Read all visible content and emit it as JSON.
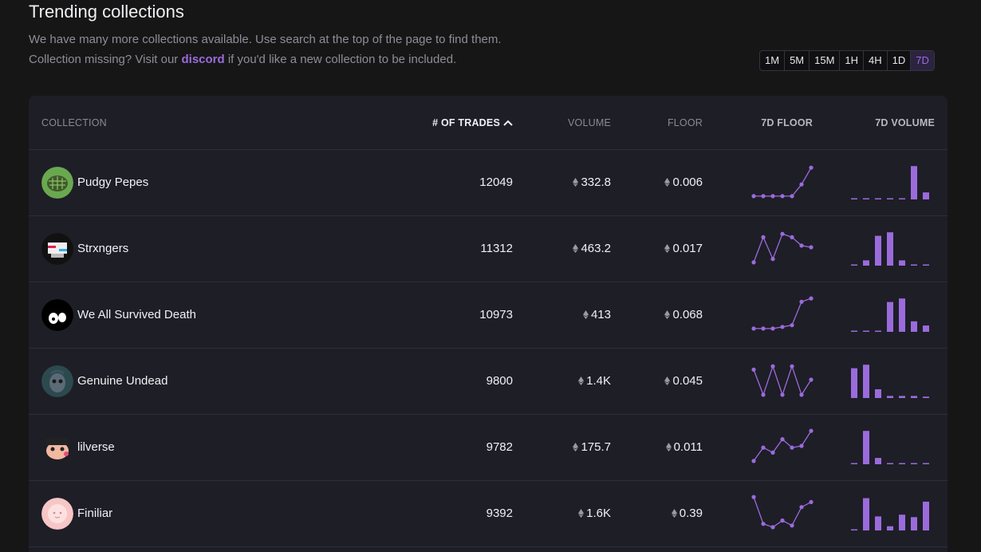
{
  "header": {
    "title": "Trending collections",
    "line1": "We have many more collections available. Use search at the top of the page to find them.",
    "line2_before": "Collection missing? Visit our ",
    "line2_link": "discord",
    "line2_after": " if you'd like a new collection to be included."
  },
  "timeframes": [
    "1M",
    "5M",
    "15M",
    "1H",
    "4H",
    "1D",
    "7D"
  ],
  "active_timeframe": "7D",
  "colors": {
    "accent": "#9b6bdc",
    "background": "#161616",
    "card": "#1e1e27"
  },
  "table": {
    "columns": {
      "collection": "COLLECTION",
      "trades": "# OF TRADES",
      "volume": "VOLUME",
      "floor": "FLOOR",
      "floor7d": "7D FLOOR",
      "volume7d": "7D VOLUME"
    },
    "sort_icon": "chevron-up-icon",
    "currency_icon": "eth-icon",
    "rows": [
      {
        "name": "Pudgy Pepes",
        "avatar_icon": "pudgy-pepes-avatar",
        "trades": "12049",
        "volume": "332.8",
        "floor": "0.006",
        "floor_trend": [
          0.05,
          0.05,
          0.05,
          0.05,
          0.05,
          0.4,
          0.9
        ],
        "volume_trend": [
          0.02,
          0.02,
          0.02,
          0.02,
          0.02,
          0.95,
          0.2
        ]
      },
      {
        "name": "Strxngers",
        "avatar_icon": "strxngers-avatar",
        "trades": "11312",
        "volume": "463.2",
        "floor": "0.017",
        "floor_trend": [
          0.05,
          0.8,
          0.15,
          0.9,
          0.8,
          0.55,
          0.5
        ],
        "volume_trend": [
          0.02,
          0.15,
          0.85,
          0.95,
          0.15,
          0.02,
          0.02
        ]
      },
      {
        "name": "We All Survived Death",
        "avatar_icon": "we-all-survived-death-avatar",
        "trades": "10973",
        "volume": "413",
        "floor": "0.068",
        "floor_trend": [
          0.05,
          0.05,
          0.05,
          0.1,
          0.15,
          0.85,
          0.95
        ],
        "volume_trend": [
          0.02,
          0.02,
          0.02,
          0.85,
          0.95,
          0.3,
          0.18
        ]
      },
      {
        "name": "Genuine Undead",
        "avatar_icon": "genuine-undead-avatar",
        "trades": "9800",
        "volume": "1.4K",
        "floor": "0.045",
        "floor_trend": [
          0.8,
          0.05,
          0.9,
          0.05,
          0.9,
          0.05,
          0.5
        ],
        "volume_trend": [
          0.85,
          0.95,
          0.25,
          0.06,
          0.06,
          0.06,
          0.04
        ]
      },
      {
        "name": "lilverse",
        "avatar_icon": "lilverse-avatar",
        "trades": "9782",
        "volume": "175.7",
        "floor": "0.011",
        "floor_trend": [
          0.05,
          0.45,
          0.3,
          0.7,
          0.45,
          0.5,
          0.95
        ],
        "volume_trend": [
          0.02,
          0.95,
          0.18,
          0.02,
          0.02,
          0.02,
          0.02
        ]
      },
      {
        "name": "Finiliar",
        "avatar_icon": "finiliar-avatar",
        "trades": "9392",
        "volume": "1.6K",
        "floor": "0.39",
        "floor_trend": [
          0.95,
          0.15,
          0.05,
          0.25,
          0.1,
          0.65,
          0.8
        ],
        "volume_trend": [
          0.02,
          0.92,
          0.4,
          0.12,
          0.45,
          0.38,
          0.82
        ]
      }
    ]
  }
}
